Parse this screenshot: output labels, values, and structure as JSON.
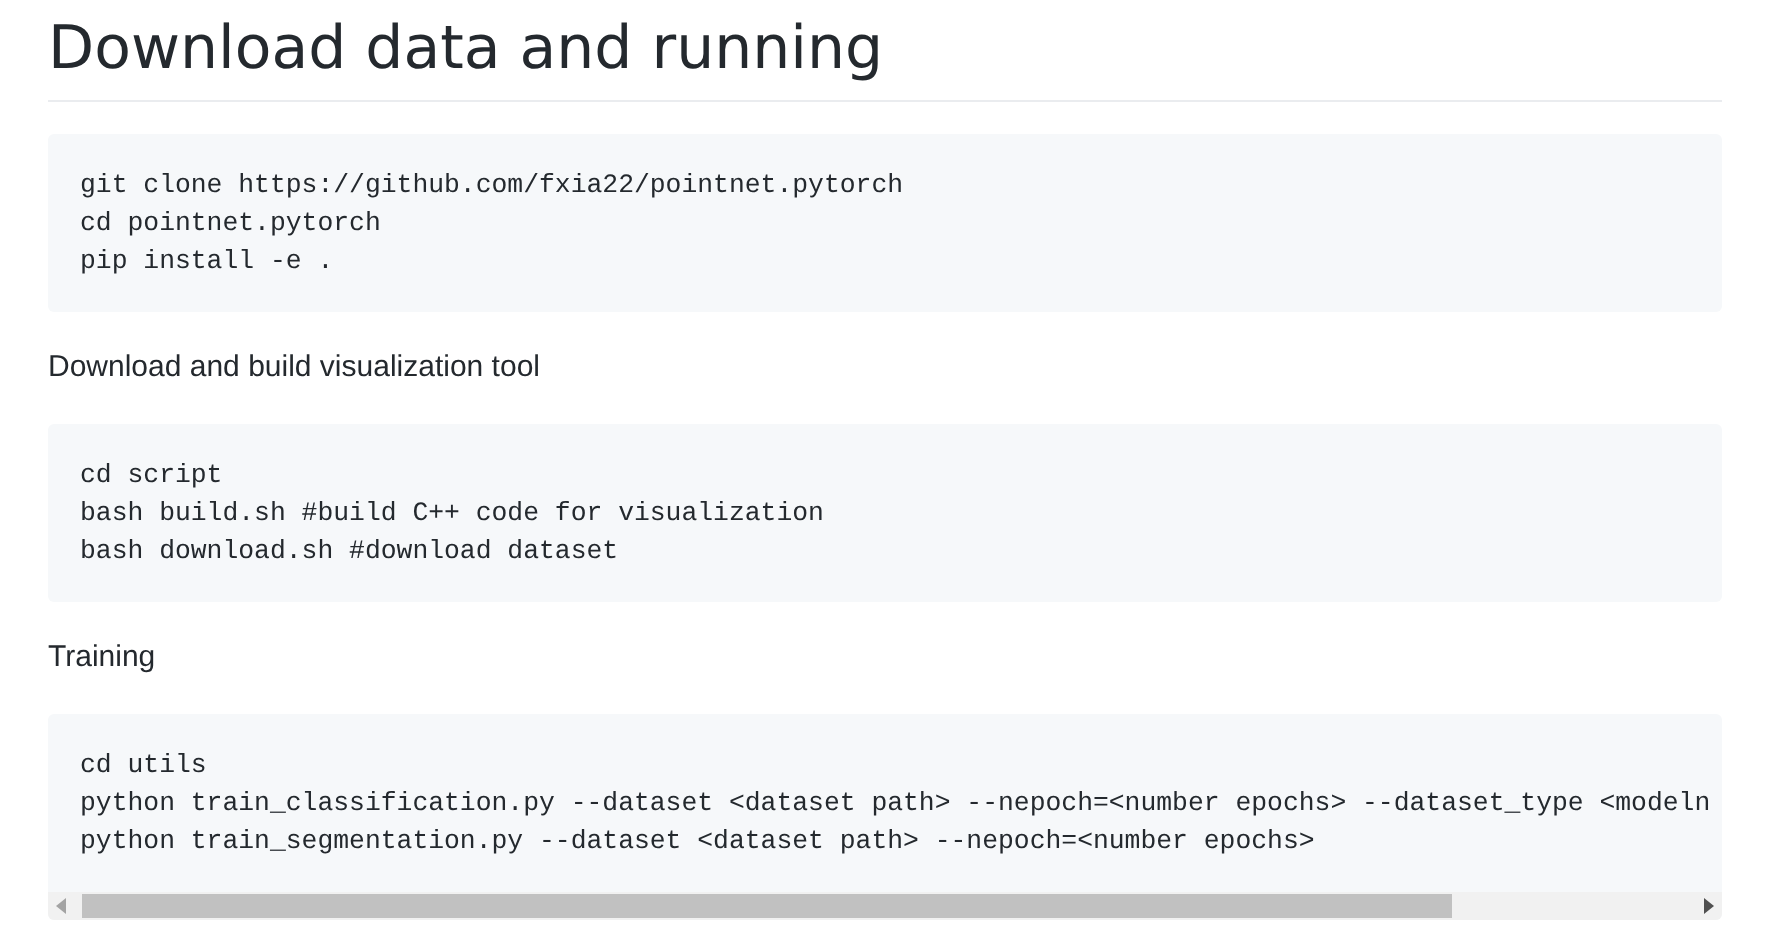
{
  "title": "Download data and running",
  "blocks": [
    {
      "kind": "code",
      "horizontal_scroll": false,
      "lines": [
        "git clone https://github.com/fxia22/pointnet.pytorch",
        "cd pointnet.pytorch",
        "pip install -e ."
      ]
    },
    {
      "kind": "text",
      "text": "Download and build visualization tool"
    },
    {
      "kind": "code",
      "horizontal_scroll": false,
      "lines": [
        "cd script",
        "bash build.sh #build C++ code for visualization",
        "bash download.sh #download dataset"
      ]
    },
    {
      "kind": "text",
      "text": "Training"
    },
    {
      "kind": "code",
      "horizontal_scroll": true,
      "lines": [
        "cd utils",
        "python train_classification.py --dataset <dataset path> --nepoch=<number epochs> --dataset_type <modeln",
        "python train_segmentation.py --dataset <dataset path> --nepoch=<number epochs>"
      ]
    }
  ]
}
